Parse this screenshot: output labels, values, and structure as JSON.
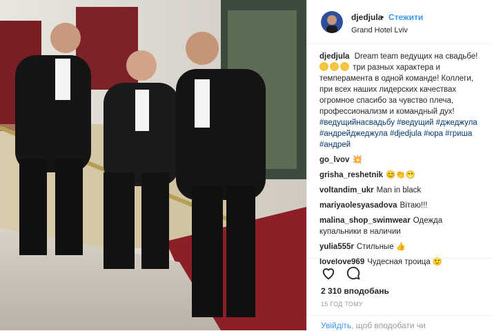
{
  "header": {
    "username": "djedjula",
    "separator": "•",
    "follow_label": "Стежити",
    "location": "Grand Hotel Lviv"
  },
  "caption": {
    "username": "djedjula",
    "text_1": "Dream team ведущих на свадьбе!",
    "text_2": "три разных характера и темперамента в одной команде! Коллеги, при всех наших лидерских качествах огромное спасибо за чувство плеча, профессионализм и командный дух!",
    "hashtags": "#ведущийнасвадьбу #ведущий #джеджула #андрейджеджула #djedjula #юра #гриша #андрей"
  },
  "comments": [
    {
      "user": "go_lvov",
      "text": "💥"
    },
    {
      "user": "grisha_reshetnik",
      "text": "😊👏😁"
    },
    {
      "user": "voltandim_ukr",
      "text": "Man in black"
    },
    {
      "user": "mariyaolesyasadova",
      "text": "Вітаю!!!"
    },
    {
      "user": "malina_shop_swimwear",
      "text": "Одежда купальники в наличии"
    },
    {
      "user": "yulia555r",
      "text": "Стильные 👍"
    },
    {
      "user": "lovelove969",
      "text": "Чудесная троица 🙂"
    }
  ],
  "actions": {
    "like_icon": "heart-icon",
    "comment_icon": "comment-icon",
    "likes": "2 310 вподобань",
    "time": "15 ГОД ТОМУ"
  },
  "login": {
    "link": "Увійдіть",
    "rest": ", щоб вподобати чи"
  },
  "colors": {
    "link": "#3897f0",
    "hashtag": "#003569",
    "border": "#efefef"
  }
}
